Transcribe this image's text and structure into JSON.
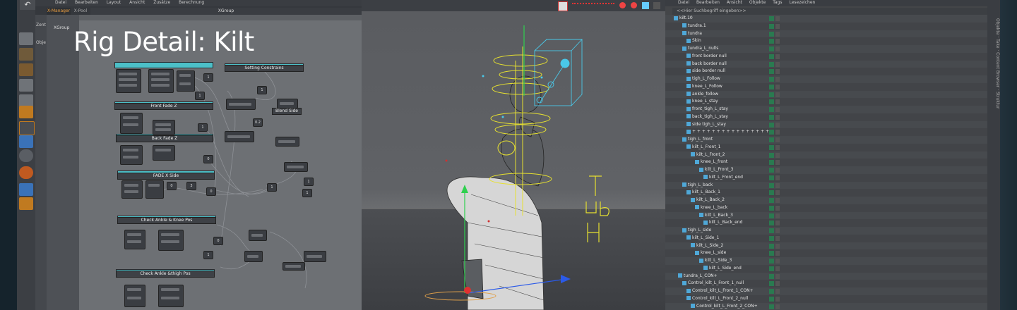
{
  "overlay_title": "Rig Detail: Kilt",
  "left_toolbar": {
    "undo_icon": "undo-icon"
  },
  "xmanager": {
    "menu": [
      "Datei",
      "Bearbeiten",
      "Layout",
      "Ansicht",
      "Zusätze",
      "Berechnung"
    ],
    "tabs": [
      "X-Manager",
      "X-Pool"
    ],
    "window_title": "XGroup",
    "side_labels": [
      "Zent",
      "Obje"
    ],
    "tree_item": "XGroup",
    "groups": [
      "Front Fade Z",
      "Back Fade Z",
      "FADE X Side",
      "Check Ankle & Knee Pos",
      "Check Ankle &thigh Pos"
    ],
    "right_groups": [
      "Setting Constrains",
      "Blend Side"
    ]
  },
  "object_manager": {
    "menu": [
      "Datei",
      "Bearbeiten",
      "Ansicht",
      "Objekte",
      "Tags",
      "Lesezeichen"
    ],
    "search_placeholder": "<<Hier Suchbegriff eingeben>>",
    "objects": [
      {
        "name": "kilt.10",
        "indent": 0
      },
      {
        "name": "tundra.1",
        "indent": 2
      },
      {
        "name": "tundra",
        "indent": 2
      },
      {
        "name": "Skin",
        "indent": 3
      },
      {
        "name": "tundra_L_nulls",
        "indent": 2
      },
      {
        "name": "front border null",
        "indent": 3
      },
      {
        "name": "back border null",
        "indent": 3
      },
      {
        "name": "side border null",
        "indent": 3
      },
      {
        "name": "tigh_L_Follow",
        "indent": 3
      },
      {
        "name": "knee_L_Follow",
        "indent": 3
      },
      {
        "name": "ankle_follow",
        "indent": 3
      },
      {
        "name": "knee_L_stay",
        "indent": 3
      },
      {
        "name": "front_tigh_L_stay",
        "indent": 3
      },
      {
        "name": "back_tigh_L_stay",
        "indent": 3
      },
      {
        "name": "side tigh_L_stay",
        "indent": 3
      },
      {
        "name": "+ + + + + + + + + + + + + + + +",
        "indent": 3
      },
      {
        "name": "tigh_L_front",
        "indent": 2
      },
      {
        "name": "kilt_L_Front_1",
        "indent": 3
      },
      {
        "name": "kilt_L_Front_2",
        "indent": 4
      },
      {
        "name": "knee_L_front",
        "indent": 5
      },
      {
        "name": "kilt_L_Front_3",
        "indent": 6
      },
      {
        "name": "kilt_L_Front_end",
        "indent": 7
      },
      {
        "name": "tigh_L_back",
        "indent": 2
      },
      {
        "name": "kilt_L_Back_1",
        "indent": 3
      },
      {
        "name": "kilt_L_Back_2",
        "indent": 4
      },
      {
        "name": "knee_L_back",
        "indent": 5
      },
      {
        "name": "kilt_L_Back_3",
        "indent": 6
      },
      {
        "name": "kilt_L_Back_end",
        "indent": 7
      },
      {
        "name": "tigh_L_side",
        "indent": 2
      },
      {
        "name": "kilt_L_Side_1",
        "indent": 3
      },
      {
        "name": "kilt_L_Side_2",
        "indent": 4
      },
      {
        "name": "knee_L_side",
        "indent": 5
      },
      {
        "name": "kilt_L_Side_3",
        "indent": 6
      },
      {
        "name": "kilt_L_Side_end",
        "indent": 7
      },
      {
        "name": "tundra_L_CON+",
        "indent": 1
      },
      {
        "name": "Control_kilt_L_Front_1_null",
        "indent": 2
      },
      {
        "name": "Control_kilt_L_Front_1_CON+",
        "indent": 3
      },
      {
        "name": "Control_kilt_L_Front_2_null",
        "indent": 3
      },
      {
        "name": "Control_kilt_L_Front_2_CON+",
        "indent": 4
      }
    ]
  },
  "right_tabs": "Objekte · Take · Content Browser · Struktur"
}
